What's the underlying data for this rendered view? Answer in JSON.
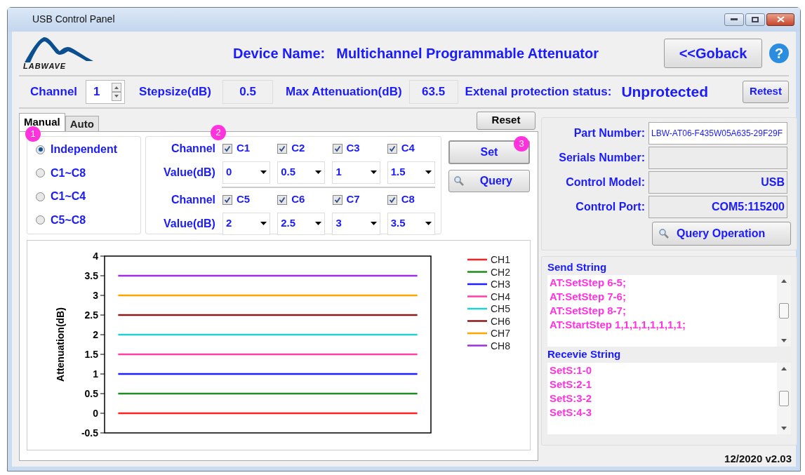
{
  "window": {
    "title": "USB Control Panel"
  },
  "logo": {
    "text": "LABWAVE"
  },
  "header": {
    "label": "Device Name:",
    "value": "Multichannel Programmable Attenuator",
    "goback": "<<Goback",
    "help": "?"
  },
  "info": {
    "channel_label": "Channel",
    "channel_value": "1",
    "stepsize_label": "Stepsize(dB)",
    "stepsize_value": "0.5",
    "max_label": "Max Attenuation(dB)",
    "max_value": "63.5",
    "protection_label": "Extenal protection status:",
    "protection_value": "Unprotected",
    "retest": "Retest"
  },
  "tabs": [
    {
      "label": "Manual",
      "selected": true
    },
    {
      "label": "Auto",
      "selected": false
    }
  ],
  "reset": "Reset",
  "badges": [
    "1",
    "2",
    "3"
  ],
  "modes": [
    {
      "label": "Independent",
      "selected": true
    },
    {
      "label": "C1~C8",
      "selected": false
    },
    {
      "label": "C1~C4",
      "selected": false
    },
    {
      "label": "C5~C8",
      "selected": false
    }
  ],
  "channel_groups": [
    {
      "channel_label": "Channel",
      "value_label": "Value(dB)",
      "channels": [
        {
          "label": "C1",
          "checked": true,
          "value": "0"
        },
        {
          "label": "C2",
          "checked": true,
          "value": "0.5"
        },
        {
          "label": "C3",
          "checked": true,
          "value": "1"
        },
        {
          "label": "C4",
          "checked": true,
          "value": "1.5"
        }
      ]
    },
    {
      "channel_label": "Channel",
      "value_label": "Value(dB)",
      "channels": [
        {
          "label": "C5",
          "checked": true,
          "value": "2"
        },
        {
          "label": "C6",
          "checked": true,
          "value": "2.5"
        },
        {
          "label": "C7",
          "checked": true,
          "value": "3"
        },
        {
          "label": "C8",
          "checked": true,
          "value": "3.5"
        }
      ]
    }
  ],
  "buttons": {
    "set": "Set",
    "query": "Query"
  },
  "chart": {
    "chart_data": {
      "type": "line",
      "legend": "right",
      "categories": [
        null,
        null,
        null,
        null,
        null,
        null,
        null,
        null,
        null,
        null,
        null,
        null
      ],
      "ylabel": "Attenuation(dB)",
      "ylim": [
        -0.5,
        4
      ],
      "yticks": [
        {
          "value": -0.5,
          "label": "-0.5"
        },
        {
          "value": 0,
          "label": "0"
        },
        {
          "value": 0.5,
          "label": "0.5"
        },
        {
          "value": 1,
          "label": "1"
        },
        {
          "value": 1.5,
          "label": "1.5"
        },
        {
          "value": 2,
          "label": "2"
        },
        {
          "value": 2.5,
          "label": "2.5"
        },
        {
          "value": 3,
          "label": "3"
        },
        {
          "value": 3.5,
          "label": "3.5"
        },
        {
          "value": 4,
          "label": "4"
        }
      ],
      "series": [
        {
          "name": "CH1",
          "color": "#ff2020",
          "values": [
            0,
            0,
            0,
            0,
            0,
            0,
            0,
            0,
            0,
            0,
            0,
            0
          ]
        },
        {
          "name": "CH2",
          "color": "#1e8c1e",
          "values": [
            0.5,
            0.5,
            0.5,
            0.5,
            0.5,
            0.5,
            0.5,
            0.5,
            0.5,
            0.5,
            0.5,
            0.5
          ]
        },
        {
          "name": "CH3",
          "color": "#2020ff",
          "values": [
            1,
            1,
            1,
            1,
            1,
            1,
            1,
            1,
            1,
            1,
            1,
            1
          ]
        },
        {
          "name": "CH4",
          "color": "#ff3fa8",
          "values": [
            1.5,
            1.5,
            1.5,
            1.5,
            1.5,
            1.5,
            1.5,
            1.5,
            1.5,
            1.5,
            1.5,
            1.5
          ]
        },
        {
          "name": "CH5",
          "color": "#20d0d0",
          "values": [
            2,
            2,
            2,
            2,
            2,
            2,
            2,
            2,
            2,
            2,
            2,
            2
          ]
        },
        {
          "name": "CH6",
          "color": "#8b1a1a",
          "values": [
            2.5,
            2.5,
            2.5,
            2.5,
            2.5,
            2.5,
            2.5,
            2.5,
            2.5,
            2.5,
            2.5,
            2.5
          ]
        },
        {
          "name": "CH7",
          "color": "#ffa500",
          "values": [
            3,
            3,
            3,
            3,
            3,
            3,
            3,
            3,
            3,
            3,
            3,
            3
          ]
        },
        {
          "name": "CH8",
          "color": "#9b30e0",
          "values": [
            3.5,
            3.5,
            3.5,
            3.5,
            3.5,
            3.5,
            3.5,
            3.5,
            3.5,
            3.5,
            3.5,
            3.5
          ]
        }
      ]
    }
  },
  "device_info": {
    "fields": [
      {
        "label": "Part Number:",
        "value": "LBW-AT06-F435W05A635-29F29F"
      },
      {
        "label": "Serials Number:"
      },
      {
        "label": "Control Model:",
        "value": "USB"
      },
      {
        "label": "Control Port:",
        "value": "COM5:115200"
      }
    ],
    "query_operation": "Query Operation"
  },
  "send": {
    "title": "Send String",
    "lines": [
      "AT:SetStep 6-5;",
      "AT:SetStep 7-6;",
      "AT:SetStep 8-7;",
      "AT:StartStep 1,1,1,1,1,1,1,1;"
    ]
  },
  "receive": {
    "title": "Recevie String",
    "lines": [
      "SetS:1-0",
      "SetS:2-1",
      "SetS:3-2",
      "SetS:4-3"
    ]
  },
  "version": "12/2020 v2.03"
}
